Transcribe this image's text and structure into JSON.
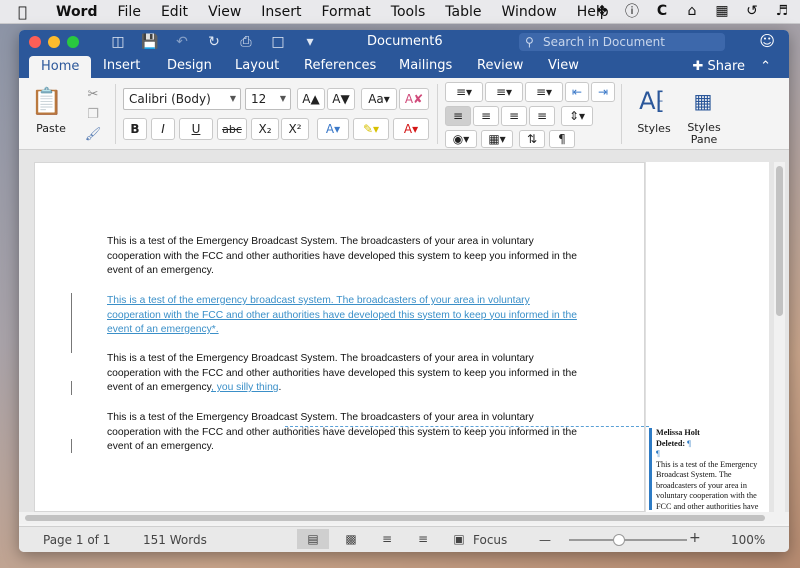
{
  "menubar": {
    "apple": "",
    "app": "Word",
    "items": [
      "File",
      "Edit",
      "View",
      "Insert",
      "Format",
      "Tools",
      "Table",
      "Window",
      "Help"
    ]
  },
  "window": {
    "title": "Document6",
    "search_placeholder": "Search in Document"
  },
  "tabs": [
    "Home",
    "Insert",
    "Design",
    "Layout",
    "References",
    "Mailings",
    "Review",
    "View"
  ],
  "share_label": "Share",
  "ribbon": {
    "paste_label": "Paste",
    "font_name": "Calibri (Body)",
    "font_size": "12",
    "bold": "B",
    "italic": "I",
    "underline": "U",
    "strike": "abc",
    "subscript": "X₂",
    "superscript": "X²",
    "pilcrow": "¶",
    "styles_label": "Styles",
    "styles_pane_label": "Styles Pane"
  },
  "document": {
    "p1": "This is a test of the Emergency Broadcast System. The broadcasters of your area in voluntary cooperation with the FCC and other authorities have developed this system to keep you informed in the event of an emergency.",
    "p2": "This is a test of the emergency broadcast system. The broadcasters of your area in voluntary cooperation with the FCC and other authorities have developed this system to keep you informed in the event of an emergency*.",
    "p3_base": "This is a test of the Emergency Broadcast System. The broadcasters of your area in voluntary cooperation with the FCC and other authorities have developed this system to keep you informed in the event of an emergency",
    "p3_insert": ", you silly thing",
    "p3_end": ".",
    "p4": "This is a test of the Emergency Broadcast System. The broadcasters of your area in voluntary cooperation with the FCC and other authorities have developed this system to keep you informed in the event of an emergency."
  },
  "comment": {
    "author": "Melissa Holt",
    "action": "Deleted:",
    "pilcrow": "¶",
    "text": "This is a test of the Emergency Broadcast System. The broadcasters of your area in voluntary cooperation with the FCC and other authorities have developed this system to keep you informed in the event"
  },
  "status": {
    "page": "Page 1 of 1",
    "words": "151 Words",
    "focus": "Focus",
    "zoom_minus": "—",
    "zoom_plus": "+",
    "zoom": "100%"
  }
}
